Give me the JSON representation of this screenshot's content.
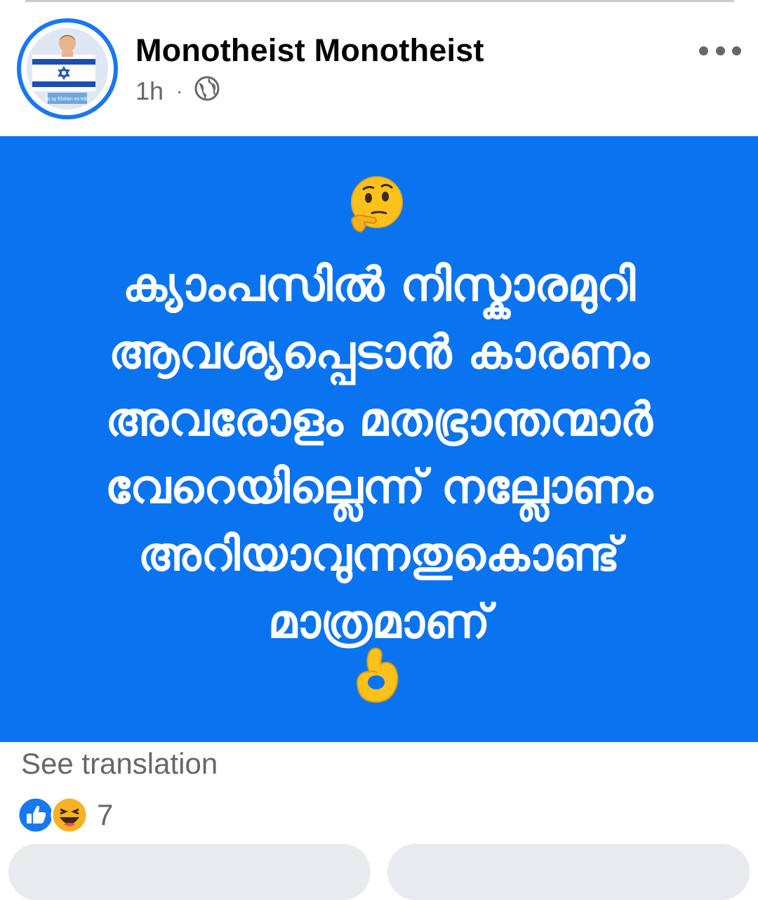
{
  "post": {
    "author": "Monotheist Monotheist",
    "time": "1h",
    "separator": "·",
    "privacy_icon": "globe-icon",
    "menu_icon": "more-dots-icon",
    "avatar_caption": "Yo sy Elohim es tribu",
    "body_lines": [
      "ക്യാംപസിൽ നിസ്കാരമുറി",
      "ആവശ്യപ്പെടാൻ കാരണം",
      "അവരോളം മതഭ്രാന്തന്മാർ",
      "വേറെയില്ലെന്ന് നല്ലോണം",
      "അറിയാവുന്നതുകൊണ്ട്",
      "മാത്രമാണ്"
    ],
    "emoji_top": "thinking-face-icon",
    "emoji_bottom": "ok-hand-icon",
    "banner_color": "#0a74f0"
  },
  "footer": {
    "see_translation": "See translation",
    "reaction_icons": [
      "like-icon",
      "haha-icon"
    ],
    "reaction_count": "7"
  }
}
